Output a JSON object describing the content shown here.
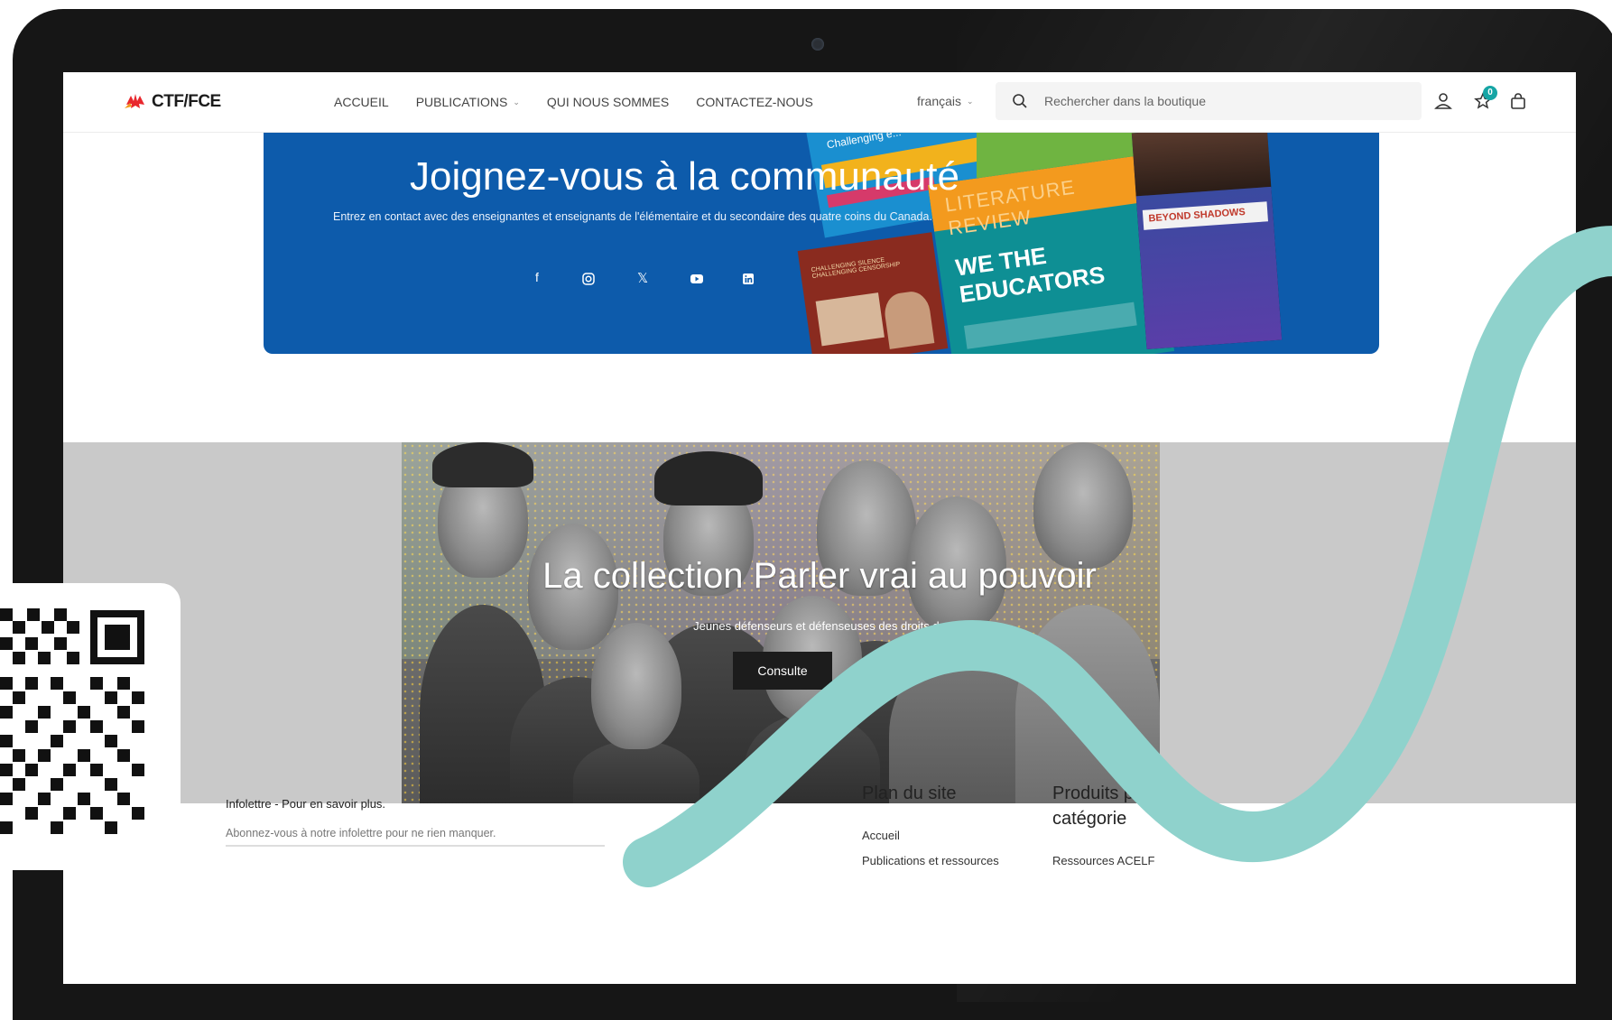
{
  "header": {
    "logo_text": "CTF/FCE",
    "nav": [
      {
        "label": "ACCUEIL"
      },
      {
        "label": "PUBLICATIONS",
        "has_dropdown": true
      },
      {
        "label": "QUI NOUS SOMMES"
      },
      {
        "label": "CONTACTEZ-NOUS"
      }
    ],
    "language": "français",
    "search_placeholder": "Rechercher dans la boutique",
    "wishlist_count": "0"
  },
  "banner": {
    "title": "Joignez-vous à la communauté",
    "subtitle": "Entrez en contact avec des enseignantes et enseignants de l'élémentaire et du secondaire des quatre coins du Canada.",
    "social": [
      "facebook-icon",
      "instagram-icon",
      "x-icon",
      "youtube-icon",
      "linkedin-icon"
    ],
    "books": [
      {
        "title": "Challenging e..."
      },
      {
        "title": "LITERATURE REVIEW"
      },
      {
        "title": "WE THE EDUCATORS"
      },
      {
        "title": "BEYOND SHADOWS"
      },
      {
        "title": "CHALLENGING SILENCE CHALLENGING CENSORSHIP"
      }
    ],
    "colors": {
      "bg": "#0d5bab",
      "accent": "#16a5a5"
    }
  },
  "hero": {
    "title": "La collection Parler vrai au pouvoir",
    "subtitle": "Jeunes défenseurs et défenseuses des droits de",
    "button_label": "Consulte"
  },
  "footer": {
    "newsletter_heading": "Infolettre - Pour en savoir plus.",
    "newsletter_text": "Abonnez-vous à notre infolettre pour ne rien manquer.",
    "sitemap": {
      "title": "Plan du site",
      "links": [
        "Accueil",
        "Publications et ressources"
      ]
    },
    "products": {
      "title_line1": "Produits par",
      "title_line2": "catégorie",
      "links": [
        "Ressources ACELF"
      ]
    }
  }
}
